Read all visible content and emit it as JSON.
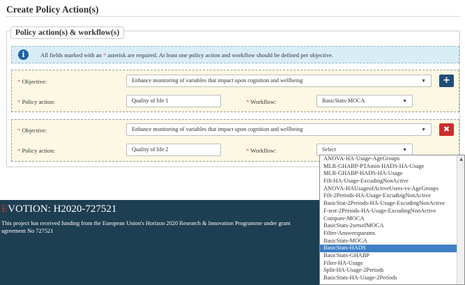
{
  "page": {
    "title": "Create Policy Action(s)"
  },
  "section": {
    "legend": "Policy action(s) & workflow(s)"
  },
  "info": {
    "text_before": "All fields marked with an ",
    "asterisk": "*",
    "text_after": " asterisk are required. At least one policy action and workflow should be defined per objective."
  },
  "labels": {
    "objective": "Objective:",
    "policy_action": "Policy action:",
    "workflow": "Workflow:",
    "required_mark": "*"
  },
  "rows": [
    {
      "objective_value": "Enhance monitoring of variables that impact upon cognition and wellbeing",
      "policy_action_value": "Quality of life 1",
      "workflow_value": "BasicStats-MOCA",
      "action_button": "+"
    },
    {
      "objective_value": "Enhance monitoring of variables that impact upon cognition and wellbeing",
      "policy_action_value": "Quality of life 2",
      "workflow_value": "Select",
      "action_button": "✖"
    }
  ],
  "caret": "▼",
  "footer": {
    "title_first_letter": "E",
    "title_rest": "VOTION: H2020-727521",
    "text": "This project has received funding from the European Union's Horizon 2020 Research & Innovation Programme under grant agreement No 727521"
  },
  "workflow_dropdown": {
    "selected": "BasicStats-HADS",
    "options": [
      "ANOVA-HA-Usage-AgeGroups",
      "MLR-GHABP-PTAmin-HADS-HA-Usage",
      "MLR-GHABP-HADS-HA-Usage",
      "Filt-HA-Usage-ExcudingNonActive",
      "ANOVA-HAUsageofActiveUsers-vs-AgeGroups",
      "Filt-2Periods-HA-Usage-ExcudingNonActive",
      "BasicStat-2Periods-HA-Usage-ExcudingNonActive",
      "F-test-2Periods-HA-Usage-ExcudingNonActive",
      "Compare-MOCA",
      "BasicStats-2setsofMOCA",
      "Filter-Answersparams",
      "BasicStats-MOCA",
      "BasicStats-HADS",
      "BasicStats-GHABP",
      "Filter-HA-Usage",
      "Split-HA-Usage-2Periods",
      "BasicStats-HA-Usage-2Periods"
    ]
  },
  "colors": {
    "info_bg": "#d9edf7",
    "objective_bg": "#fcf8e3",
    "add_button": "#1f4e79",
    "delete_button": "#c9302c",
    "footer_bg": "#1e3e51",
    "highlight": "#3e7fc6"
  }
}
